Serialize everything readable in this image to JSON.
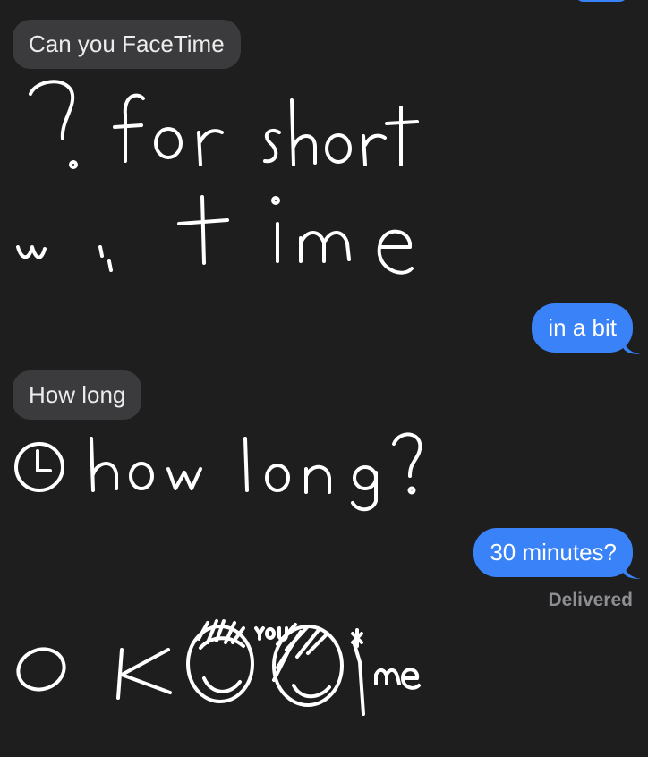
{
  "conversation": {
    "messages": [
      {
        "sender": "them",
        "type": "text",
        "text": "Can you FaceTime"
      },
      {
        "sender": "them",
        "type": "handwriting"
      },
      {
        "sender": "me",
        "type": "text",
        "text": "in a bit"
      },
      {
        "sender": "them",
        "type": "text",
        "text": "How long"
      },
      {
        "sender": "them",
        "type": "handwriting"
      },
      {
        "sender": "me",
        "type": "text",
        "text": "30 minutes?"
      },
      {
        "sender": "them",
        "type": "handwriting"
      }
    ],
    "status": "Delivered"
  },
  "colors": {
    "background": "#1e1e1e",
    "incoming_bubble": "#3b3b3d",
    "outgoing_bubble": "#3a82f7",
    "status_text": "#8e8e93"
  }
}
